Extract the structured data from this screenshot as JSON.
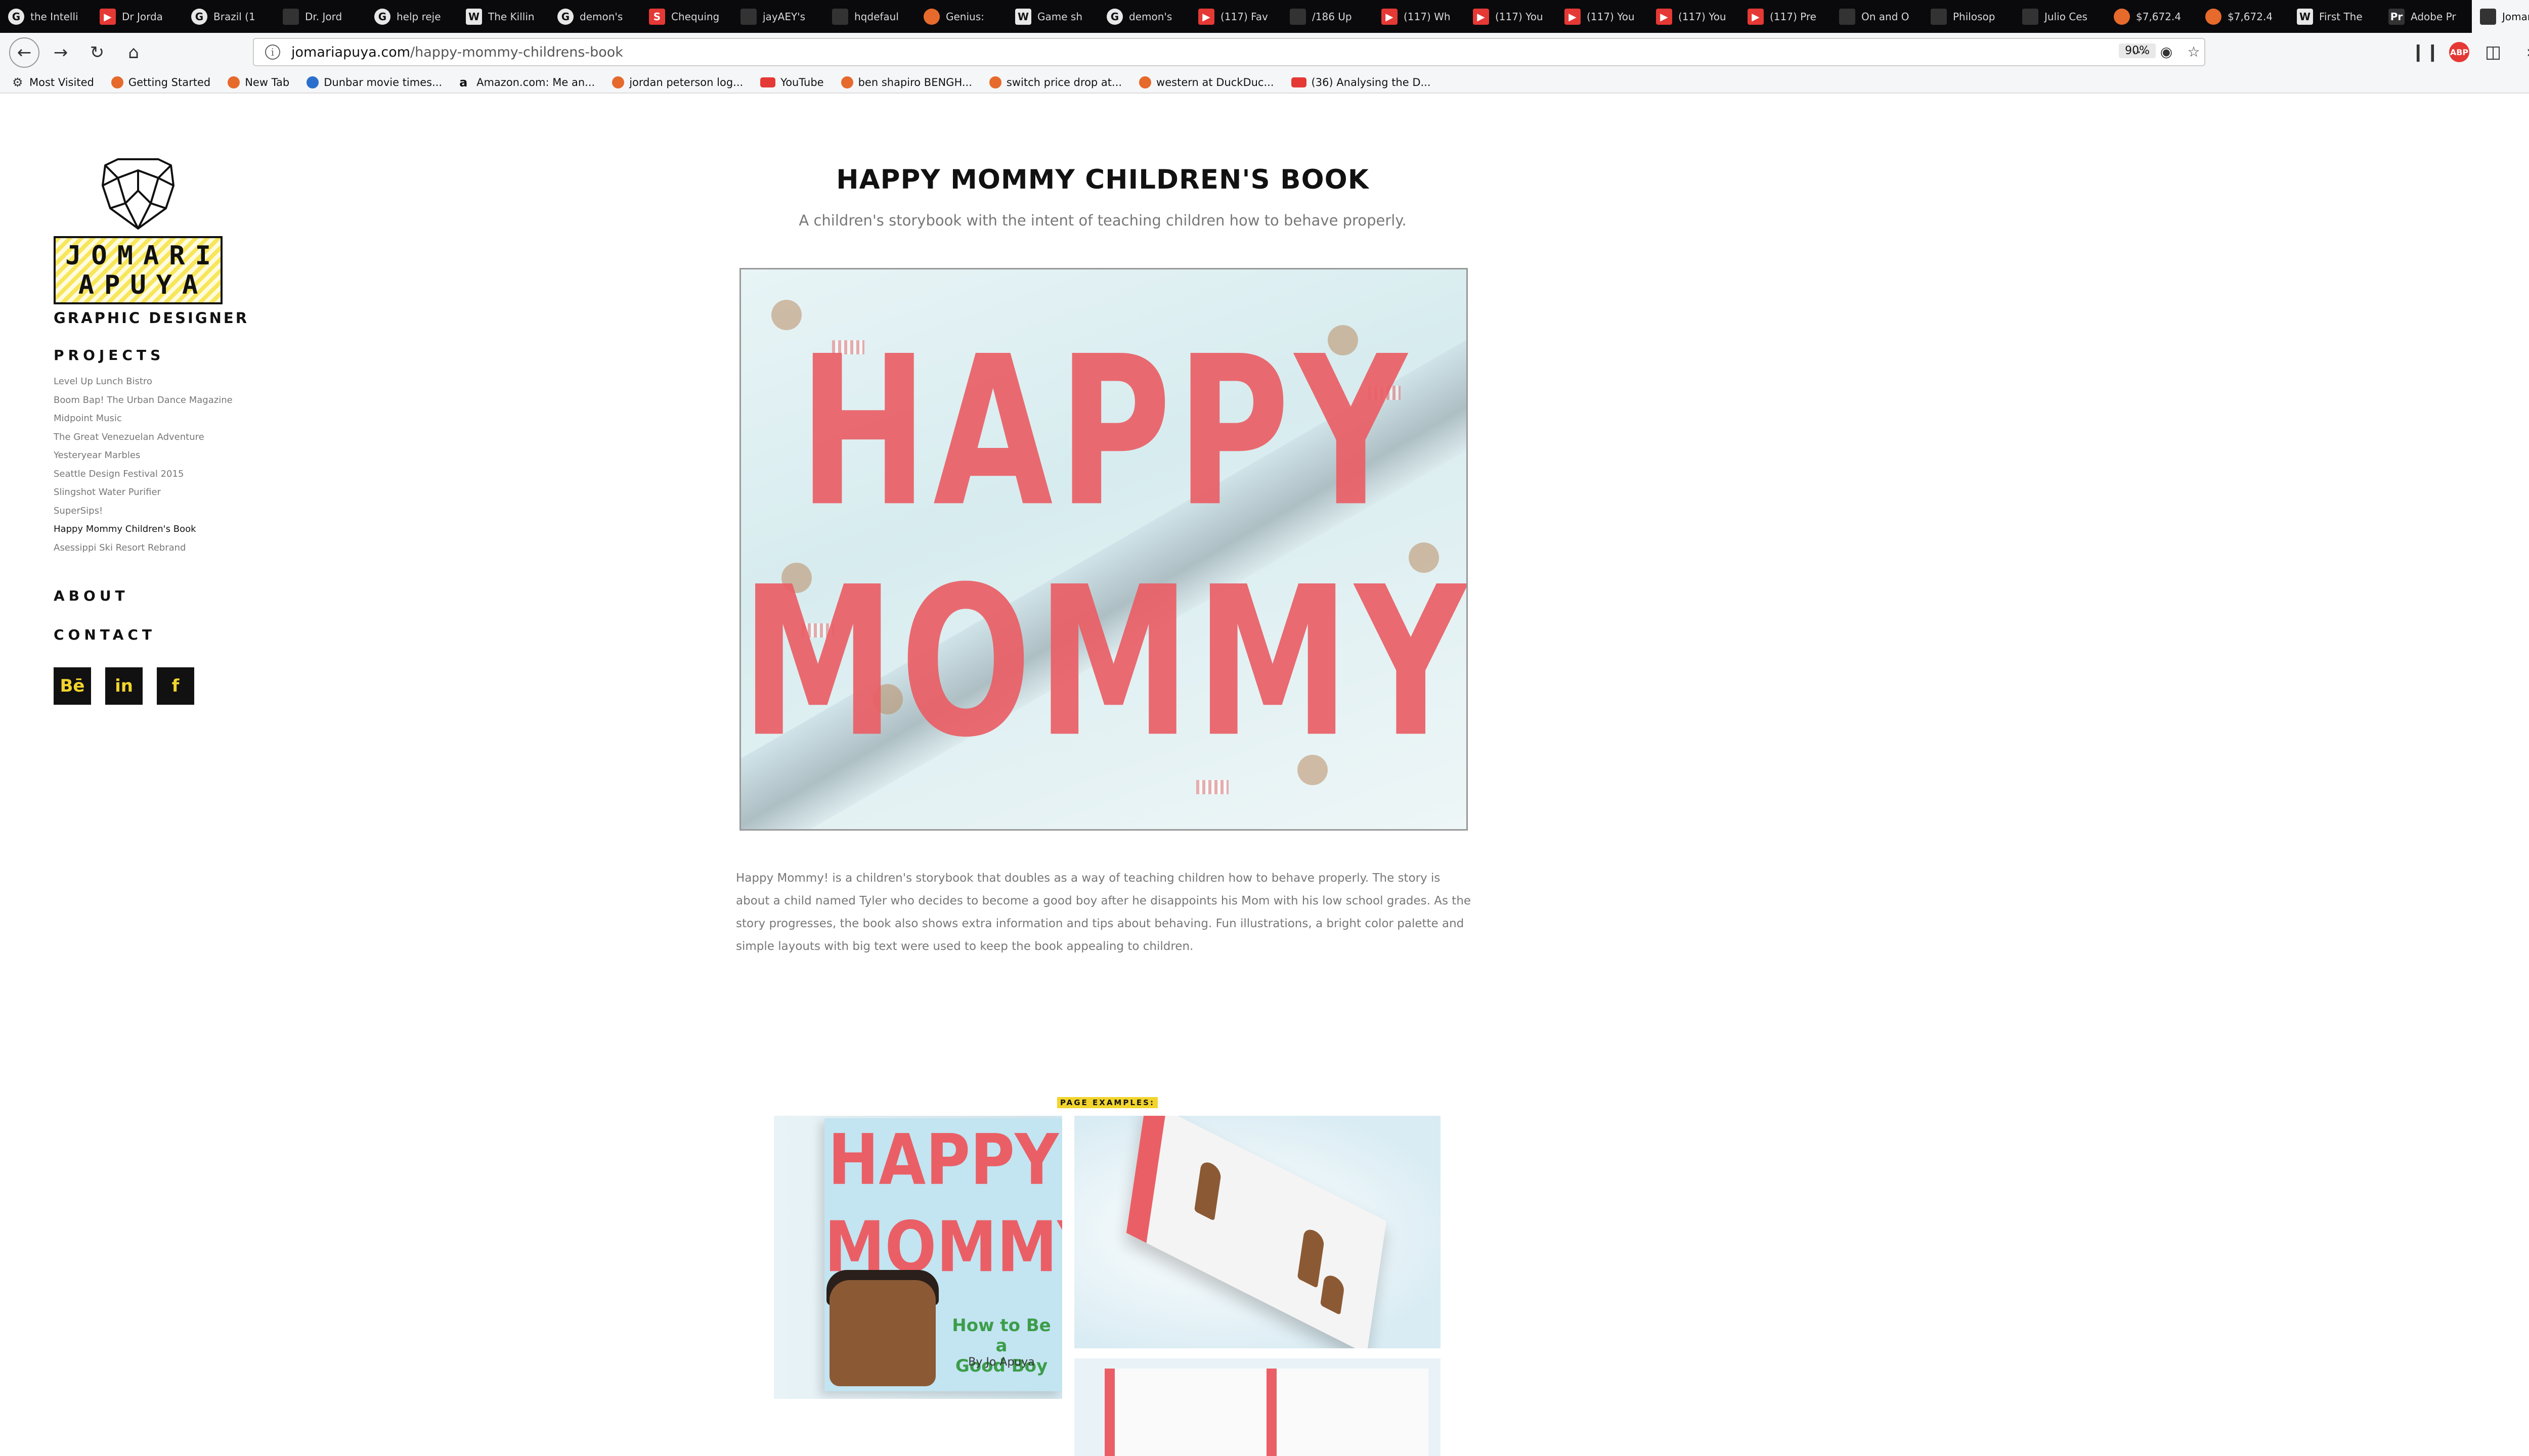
{
  "browser": {
    "tabs": [
      {
        "label": "the Intelli",
        "icon": "google-icon"
      },
      {
        "label": "Dr Jorda",
        "icon": "youtube-icon"
      },
      {
        "label": "Brazil (1",
        "icon": "google-icon"
      },
      {
        "label": "Dr. Jord",
        "icon": "site-icon"
      },
      {
        "label": "help reje",
        "icon": "google-icon"
      },
      {
        "label": "The Killin",
        "icon": "wikipedia-icon"
      },
      {
        "label": "demon's",
        "icon": "google-icon"
      },
      {
        "label": "Chequing",
        "icon": "scotiabank-icon"
      },
      {
        "label": "jayAEY's",
        "icon": "site-icon"
      },
      {
        "label": "hqdefaul",
        "icon": "image-icon"
      },
      {
        "label": "Genius:",
        "icon": "duckduckgo-icon"
      },
      {
        "label": "Game sh",
        "icon": "wikipedia-icon"
      },
      {
        "label": "demon's",
        "icon": "google-icon"
      },
      {
        "label": "(117) Fav",
        "icon": "youtube-icon"
      },
      {
        "label": "/186 Up",
        "icon": "site-icon"
      },
      {
        "label": "(117) Wh",
        "icon": "youtube-icon"
      },
      {
        "label": "(117) You",
        "icon": "youtube-icon"
      },
      {
        "label": "(117) You",
        "icon": "youtube-icon"
      },
      {
        "label": "(117) You",
        "icon": "youtube-icon"
      },
      {
        "label": "(117) Pre",
        "icon": "youtube-icon"
      },
      {
        "label": "On and O",
        "icon": "site-icon"
      },
      {
        "label": "Philosop",
        "icon": "site-icon"
      },
      {
        "label": "Julio Ces",
        "icon": "site-icon"
      },
      {
        "label": "$7,672.4",
        "icon": "duckduckgo-icon"
      },
      {
        "label": "$7,672.4",
        "icon": "duckduckgo-icon"
      },
      {
        "label": "First The",
        "icon": "wikipedia-icon"
      },
      {
        "label": "Adobe Pr",
        "icon": "adobe-icon"
      },
      {
        "label": "Jomar",
        "icon": "site-icon",
        "active": true
      }
    ],
    "url_host": "jomariapuya.com",
    "url_path": "/happy-mommy-childrens-book",
    "zoom": "90%",
    "bookmarks": [
      {
        "label": "Most Visited",
        "icon": "gear-icon"
      },
      {
        "label": "Getting Started",
        "icon": "firefox-icon"
      },
      {
        "label": "New Tab",
        "icon": "firefox-icon"
      },
      {
        "label": "Dunbar movie times...",
        "icon": "globe-icon"
      },
      {
        "label": "Amazon.com: Me an...",
        "icon": "amazon-icon"
      },
      {
        "label": "jordan peterson log...",
        "icon": "duckduckgo-icon"
      },
      {
        "label": "YouTube",
        "icon": "youtube-icon"
      },
      {
        "label": "ben shapiro BENGH...",
        "icon": "duckduckgo-icon"
      },
      {
        "label": "switch price drop at...",
        "icon": "duckduckgo-icon"
      },
      {
        "label": "western at DuckDuc...",
        "icon": "duckduckgo-icon"
      },
      {
        "label": "(36) Analysing the D...",
        "icon": "youtube-icon"
      }
    ]
  },
  "sidebar": {
    "logo_line1": "JOMARI",
    "logo_line2": "APUYA",
    "designer_title": "GRAPHIC DESIGNER",
    "projects_heading": "PROJECTS",
    "projects": [
      "Level Up Lunch Bistro",
      "Boom Bap! The Urban Dance Magazine",
      "Midpoint Music",
      "The Great Venezuelan Adventure",
      "Yesteryear Marbles",
      "Seattle Design Festival 2015",
      "Slingshot Water Purifier",
      "SuperSips!",
      "Happy Mommy Children's Book",
      "Asessippi Ski Resort Rebrand"
    ],
    "current_project_index": 8,
    "about": "ABOUT",
    "contact": "CONTACT",
    "social": {
      "behance": "Bē",
      "linkedin": "in",
      "facebook": "f"
    }
  },
  "main": {
    "title": "HAPPY MOMMY CHILDREN'S BOOK",
    "subtitle": "A children's storybook with the intent of teaching children how to behave properly.",
    "hero_line1": "HAPPY",
    "hero_line2": "MOMMY",
    "description": "Happy Mommy! is a children's storybook that doubles as a way of teaching children how to behave properly. The story is about a child named Tyler who decides to become a good boy after he disappoints his Mom with his low school grades. As the story progresses, the book also shows extra information and tips about behaving. Fun illustrations, a bright color palette and simple layouts with big text were used to keep the book appealing to children.",
    "page_examples_label": "PAGE EXAMPLES:",
    "cover_title_line1": "HAPPY",
    "cover_title_line2": "MOMMY",
    "cover_subtitle_line1": "How to Be a",
    "cover_subtitle_line2": "Good Boy",
    "cover_byline": "By Jo Apuya"
  },
  "colors": {
    "accent_yellow": "#f2d42d",
    "book_red": "#ea5f66",
    "text_dark": "#111111",
    "text_muted": "#777777"
  }
}
